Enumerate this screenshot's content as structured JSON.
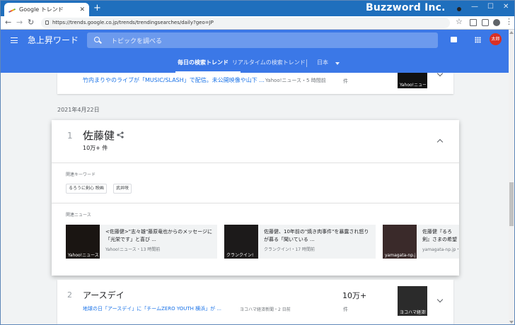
{
  "browser": {
    "tab_title": "Google トレンド",
    "url": "https://trends.google.co.jp/trends/trendingsearches/daily?geo=JP",
    "watermark": "Buzzword Inc."
  },
  "app": {
    "title": "急上昇ワード",
    "search_placeholder": "トピックを調べる",
    "avatar_text": "太郎",
    "tabs": [
      "毎日の検索トレンド",
      "リアルタイムの検索トレンド"
    ],
    "region": "日本"
  },
  "prev_item": {
    "headline": "竹内まりやのライブが「MUSIC/SLASH」で配信。未公開映像や山下 ...",
    "source_time": "Yahoo!ニュース・5 時間前",
    "count_unit": "件",
    "thumb_caption": "Yahoo!ニュース"
  },
  "date_label": "2021年4月22日",
  "expanded": {
    "rank": "1",
    "title": "佐藤健",
    "count": "10万+ 件",
    "related_keywords_label": "関連キーワード",
    "keywords": [
      "るろうに剣心 映画",
      "武井咲"
    ],
    "related_news_label": "関連ニュース",
    "news": [
      {
        "headline": "<佐藤健>\"志々雄\"藤原竜也からのメッセージに「光栄です」と喜び ...",
        "source_time": "Yahoo!ニュース・13 時間前",
        "thumb_caption": "Yahoo!ニュース"
      },
      {
        "headline": "佐藤健、10年前の\"焼き肉事件\"を暴露され怒りが募る「聞いている ...",
        "source_time": "クランクイン!・17 時間前",
        "thumb_caption": "クランクイン!"
      },
      {
        "headline": "佐藤健『るろ剣』さまの希望の光",
        "source_time": "yamagata-np.jp・",
        "thumb_caption": "yamagata-np.jp"
      }
    ]
  },
  "item2": {
    "rank": "2",
    "title": "アースデイ",
    "count": "10万+",
    "count_unit": "件",
    "headline": "地球の日「アースデイ」に「チームZERO YOUTH 横浜」が ...",
    "source_time": "ヨコハマ経済新聞・2 日前",
    "thumb_caption": "ヨコハマ経済新聞"
  }
}
